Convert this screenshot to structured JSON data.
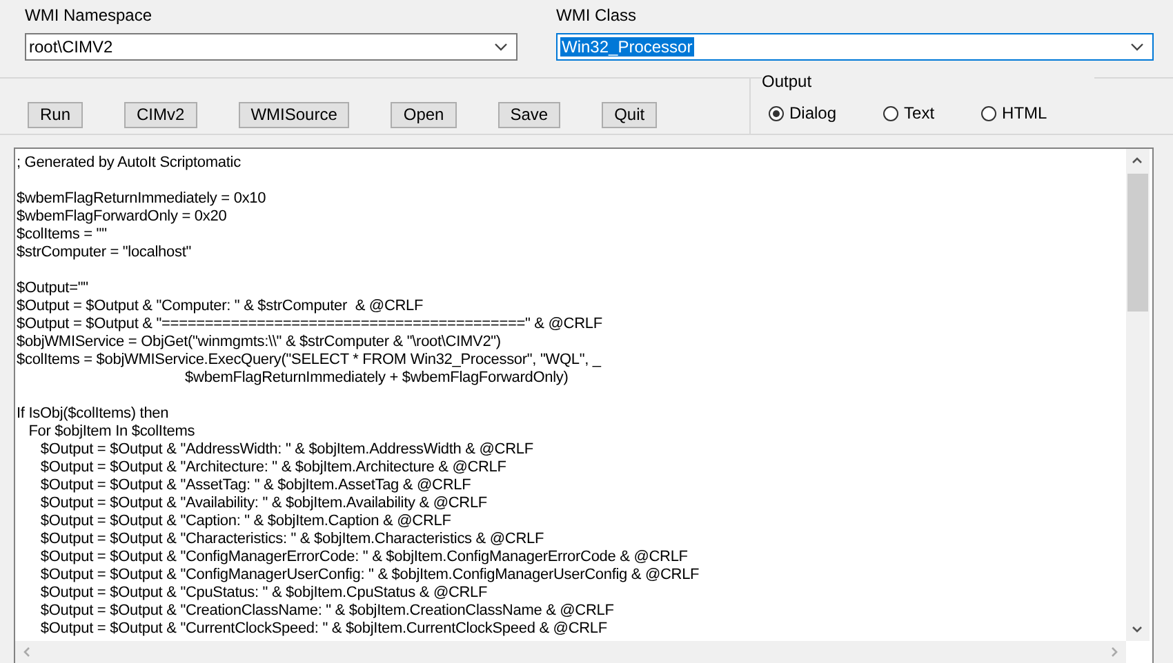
{
  "namespace": {
    "label": "WMI Namespace",
    "value": "root\\CIMV2"
  },
  "wmi_class": {
    "label": "WMI Class",
    "value": "Win32_Processor",
    "selected": true
  },
  "buttons": [
    "Run",
    "CIMv2",
    "WMISource",
    "Open",
    "Save",
    "Quit"
  ],
  "output": {
    "label": "Output",
    "options": [
      {
        "label": "Dialog",
        "selected": true
      },
      {
        "label": "Text",
        "selected": false
      },
      {
        "label": "HTML",
        "selected": false
      }
    ]
  },
  "code": [
    [
      "; Generated by AutoIt Scriptomatic"
    ],
    [
      "$wbemFlagReturnImmediately = 0x10",
      "$wbemFlagForwardOnly = 0x20",
      "$colItems = \"\"",
      "$strComputer = \"localhost\""
    ],
    [
      "$Output=\"\"",
      "$Output = $Output & \"Computer: \" & $strComputer  & @CRLF",
      "$Output = $Output & \"==========================================\" & @CRLF",
      "$objWMIService = ObjGet(\"winmgmts:\\\\\" & $strComputer & \"\\root\\CIMV2\")",
      "$colItems = $objWMIService.ExecQuery(\"SELECT * FROM Win32_Processor\", \"WQL\", _",
      "                                          $wbemFlagReturnImmediately + $wbemFlagForwardOnly)"
    ],
    [
      "If IsObj($colItems) then",
      "   For $objItem In $colItems",
      "      $Output = $Output & \"AddressWidth: \" & $objItem.AddressWidth & @CRLF",
      "      $Output = $Output & \"Architecture: \" & $objItem.Architecture & @CRLF",
      "      $Output = $Output & \"AssetTag: \" & $objItem.AssetTag & @CRLF",
      "      $Output = $Output & \"Availability: \" & $objItem.Availability & @CRLF",
      "      $Output = $Output & \"Caption: \" & $objItem.Caption & @CRLF",
      "      $Output = $Output & \"Characteristics: \" & $objItem.Characteristics & @CRLF",
      "      $Output = $Output & \"ConfigManagerErrorCode: \" & $objItem.ConfigManagerErrorCode & @CRLF",
      "      $Output = $Output & \"ConfigManagerUserConfig: \" & $objItem.ConfigManagerUserConfig & @CRLF",
      "      $Output = $Output & \"CpuStatus: \" & $objItem.CpuStatus & @CRLF",
      "      $Output = $Output & \"CreationClassName: \" & $objItem.CreationClassName & @CRLF",
      "      $Output = $Output & \"CurrentClockSpeed: \" & $objItem.CurrentClockSpeed & @CRLF"
    ]
  ]
}
